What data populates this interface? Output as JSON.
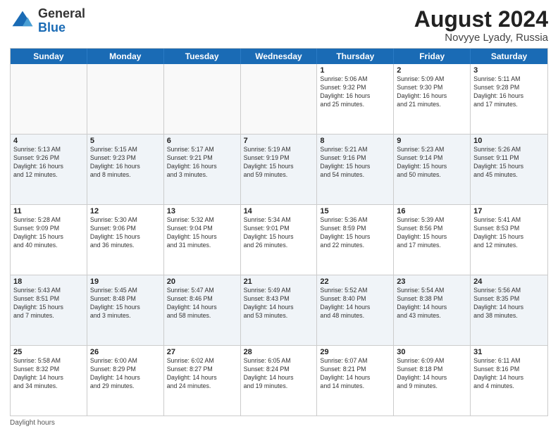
{
  "header": {
    "logo": {
      "general": "General",
      "blue": "Blue"
    },
    "month_year": "August 2024",
    "location": "Novyye Lyady, Russia"
  },
  "days_of_week": [
    "Sunday",
    "Monday",
    "Tuesday",
    "Wednesday",
    "Thursday",
    "Friday",
    "Saturday"
  ],
  "weeks": [
    [
      {
        "day": "",
        "info": ""
      },
      {
        "day": "",
        "info": ""
      },
      {
        "day": "",
        "info": ""
      },
      {
        "day": "",
        "info": ""
      },
      {
        "day": "1",
        "info": "Sunrise: 5:06 AM\nSunset: 9:32 PM\nDaylight: 16 hours\nand 25 minutes."
      },
      {
        "day": "2",
        "info": "Sunrise: 5:09 AM\nSunset: 9:30 PM\nDaylight: 16 hours\nand 21 minutes."
      },
      {
        "day": "3",
        "info": "Sunrise: 5:11 AM\nSunset: 9:28 PM\nDaylight: 16 hours\nand 17 minutes."
      }
    ],
    [
      {
        "day": "4",
        "info": "Sunrise: 5:13 AM\nSunset: 9:26 PM\nDaylight: 16 hours\nand 12 minutes."
      },
      {
        "day": "5",
        "info": "Sunrise: 5:15 AM\nSunset: 9:23 PM\nDaylight: 16 hours\nand 8 minutes."
      },
      {
        "day": "6",
        "info": "Sunrise: 5:17 AM\nSunset: 9:21 PM\nDaylight: 16 hours\nand 3 minutes."
      },
      {
        "day": "7",
        "info": "Sunrise: 5:19 AM\nSunset: 9:19 PM\nDaylight: 15 hours\nand 59 minutes."
      },
      {
        "day": "8",
        "info": "Sunrise: 5:21 AM\nSunset: 9:16 PM\nDaylight: 15 hours\nand 54 minutes."
      },
      {
        "day": "9",
        "info": "Sunrise: 5:23 AM\nSunset: 9:14 PM\nDaylight: 15 hours\nand 50 minutes."
      },
      {
        "day": "10",
        "info": "Sunrise: 5:26 AM\nSunset: 9:11 PM\nDaylight: 15 hours\nand 45 minutes."
      }
    ],
    [
      {
        "day": "11",
        "info": "Sunrise: 5:28 AM\nSunset: 9:09 PM\nDaylight: 15 hours\nand 40 minutes."
      },
      {
        "day": "12",
        "info": "Sunrise: 5:30 AM\nSunset: 9:06 PM\nDaylight: 15 hours\nand 36 minutes."
      },
      {
        "day": "13",
        "info": "Sunrise: 5:32 AM\nSunset: 9:04 PM\nDaylight: 15 hours\nand 31 minutes."
      },
      {
        "day": "14",
        "info": "Sunrise: 5:34 AM\nSunset: 9:01 PM\nDaylight: 15 hours\nand 26 minutes."
      },
      {
        "day": "15",
        "info": "Sunrise: 5:36 AM\nSunset: 8:59 PM\nDaylight: 15 hours\nand 22 minutes."
      },
      {
        "day": "16",
        "info": "Sunrise: 5:39 AM\nSunset: 8:56 PM\nDaylight: 15 hours\nand 17 minutes."
      },
      {
        "day": "17",
        "info": "Sunrise: 5:41 AM\nSunset: 8:53 PM\nDaylight: 15 hours\nand 12 minutes."
      }
    ],
    [
      {
        "day": "18",
        "info": "Sunrise: 5:43 AM\nSunset: 8:51 PM\nDaylight: 15 hours\nand 7 minutes."
      },
      {
        "day": "19",
        "info": "Sunrise: 5:45 AM\nSunset: 8:48 PM\nDaylight: 15 hours\nand 3 minutes."
      },
      {
        "day": "20",
        "info": "Sunrise: 5:47 AM\nSunset: 8:46 PM\nDaylight: 14 hours\nand 58 minutes."
      },
      {
        "day": "21",
        "info": "Sunrise: 5:49 AM\nSunset: 8:43 PM\nDaylight: 14 hours\nand 53 minutes."
      },
      {
        "day": "22",
        "info": "Sunrise: 5:52 AM\nSunset: 8:40 PM\nDaylight: 14 hours\nand 48 minutes."
      },
      {
        "day": "23",
        "info": "Sunrise: 5:54 AM\nSunset: 8:38 PM\nDaylight: 14 hours\nand 43 minutes."
      },
      {
        "day": "24",
        "info": "Sunrise: 5:56 AM\nSunset: 8:35 PM\nDaylight: 14 hours\nand 38 minutes."
      }
    ],
    [
      {
        "day": "25",
        "info": "Sunrise: 5:58 AM\nSunset: 8:32 PM\nDaylight: 14 hours\nand 34 minutes."
      },
      {
        "day": "26",
        "info": "Sunrise: 6:00 AM\nSunset: 8:29 PM\nDaylight: 14 hours\nand 29 minutes."
      },
      {
        "day": "27",
        "info": "Sunrise: 6:02 AM\nSunset: 8:27 PM\nDaylight: 14 hours\nand 24 minutes."
      },
      {
        "day": "28",
        "info": "Sunrise: 6:05 AM\nSunset: 8:24 PM\nDaylight: 14 hours\nand 19 minutes."
      },
      {
        "day": "29",
        "info": "Sunrise: 6:07 AM\nSunset: 8:21 PM\nDaylight: 14 hours\nand 14 minutes."
      },
      {
        "day": "30",
        "info": "Sunrise: 6:09 AM\nSunset: 8:18 PM\nDaylight: 14 hours\nand 9 minutes."
      },
      {
        "day": "31",
        "info": "Sunrise: 6:11 AM\nSunset: 8:16 PM\nDaylight: 14 hours\nand 4 minutes."
      }
    ]
  ],
  "footer": {
    "daylight_label": "Daylight hours"
  }
}
